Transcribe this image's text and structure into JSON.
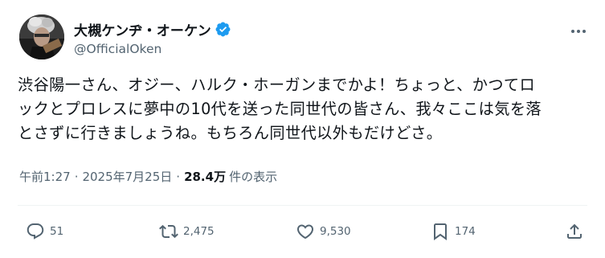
{
  "author": {
    "display_name": "大槻ケンヂ・オーケン",
    "handle": "@OfficialOken",
    "verified": true
  },
  "post": {
    "lines": [
      "渋谷陽一さん、オジー、ハルク・ホーガンまでかよ！ちょっと、かつてロ",
      "ックとプロレスに夢中の10代を送った同世代の皆さん、我々ここは気を落",
      "とさずに行きましょうね。もちろん同世代以外もだけどさ。"
    ]
  },
  "meta": {
    "time": "午前1:27",
    "separator": "·",
    "date": "2025年7月25日",
    "views_count": "28.4万",
    "views_label": "件の表示"
  },
  "actions": {
    "replies": "51",
    "reposts": "2,475",
    "likes": "9,530",
    "bookmarks": "174"
  },
  "colors": {
    "text": "#0f1419",
    "secondary": "#536471",
    "verified": "#1d9bf0",
    "divider": "#eff3f4"
  },
  "icons": [
    "avatar",
    "verified-badge-icon",
    "more-icon",
    "reply-icon",
    "repost-icon",
    "like-icon",
    "bookmark-icon",
    "share-icon"
  ]
}
